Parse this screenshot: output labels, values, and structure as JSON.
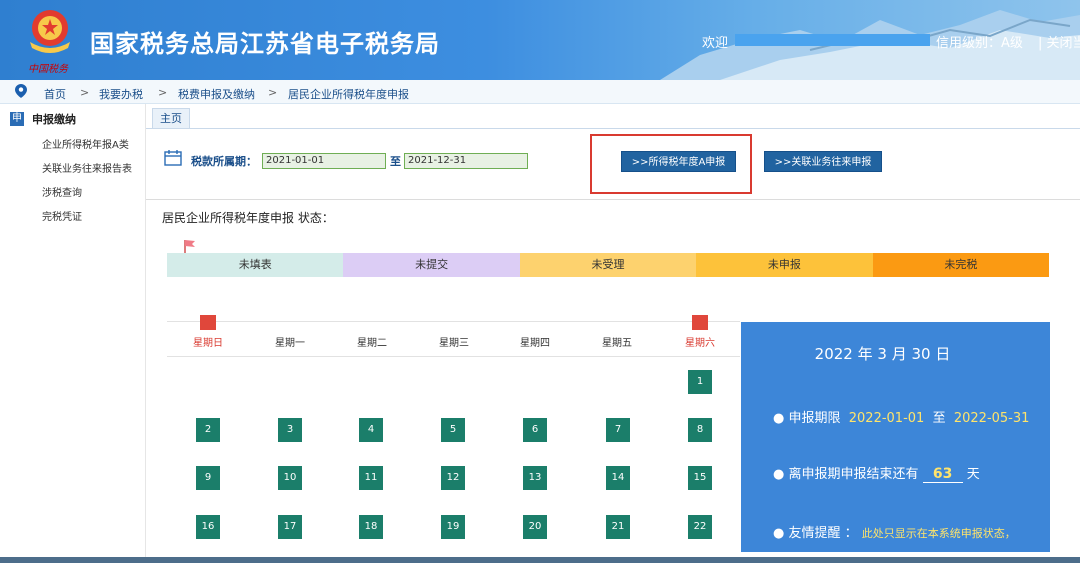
{
  "header": {
    "site_title": "国家税务总局江苏省电子税务局",
    "emblem_caption": "中国税务",
    "welcome": "欢迎",
    "credit_level": "信用级别：A级",
    "close_link": "| 关闭当"
  },
  "breadcrumb": {
    "items": [
      "首页",
      "我要办税",
      "税费申报及缴纳",
      "居民企业所得税年度申报"
    ],
    "separator": ">"
  },
  "sidebar": {
    "head_icon": "申",
    "head_label": "申报缴纳",
    "items": [
      "企业所得税年报A类",
      "关联业务往来报告表",
      "涉税查询",
      "完税凭证"
    ]
  },
  "tab": {
    "label": "主页"
  },
  "period": {
    "label": "税款所属期：",
    "start": "2021-01-01",
    "to_label": "至",
    "end": "2021-12-31"
  },
  "buttons": {
    "annual_a": ">>所得税年度A申报",
    "related_party": ">>关联业务往来申报"
  },
  "status": {
    "title": "居民企业所得税年度申报 状态：",
    "segments": [
      {
        "label": "未填表",
        "color": "#d4ece9"
      },
      {
        "label": "未提交",
        "color": "#dccdf5"
      },
      {
        "label": "未受理",
        "color": "#fdd26e"
      },
      {
        "label": "未申报",
        "color": "#fdc23a"
      },
      {
        "label": "未完税",
        "color": "#fb9a12"
      }
    ]
  },
  "calendar": {
    "weekdays": [
      "星期日",
      "星期一",
      "星期二",
      "星期三",
      "星期四",
      "星期五",
      "星期六"
    ],
    "days": [
      "1",
      "2",
      "3",
      "4",
      "5",
      "6",
      "7",
      "8",
      "9",
      "10",
      "11",
      "12",
      "13",
      "14",
      "15",
      "16",
      "17",
      "18",
      "19",
      "20",
      "21",
      "22"
    ]
  },
  "info": {
    "date": "2022 年 3 月 30 日",
    "period_label": "● 申报期限",
    "period_start": "2022-01-01",
    "period_to": "至",
    "period_end": "2022-05-31",
    "deadline_prefix": "● 离申报期申报结束还有",
    "deadline_days": "63",
    "deadline_suffix": "天",
    "tip_label": "● 友情提醒 ：",
    "tip_text": "此处只显示在本系统申报状态，"
  },
  "colors": {
    "header_blue": "#3d8ee0",
    "button_blue": "#2163a0",
    "day_green": "#1b7e6a",
    "panel_blue": "#3d86d8",
    "highlight_red": "#d93a30"
  }
}
